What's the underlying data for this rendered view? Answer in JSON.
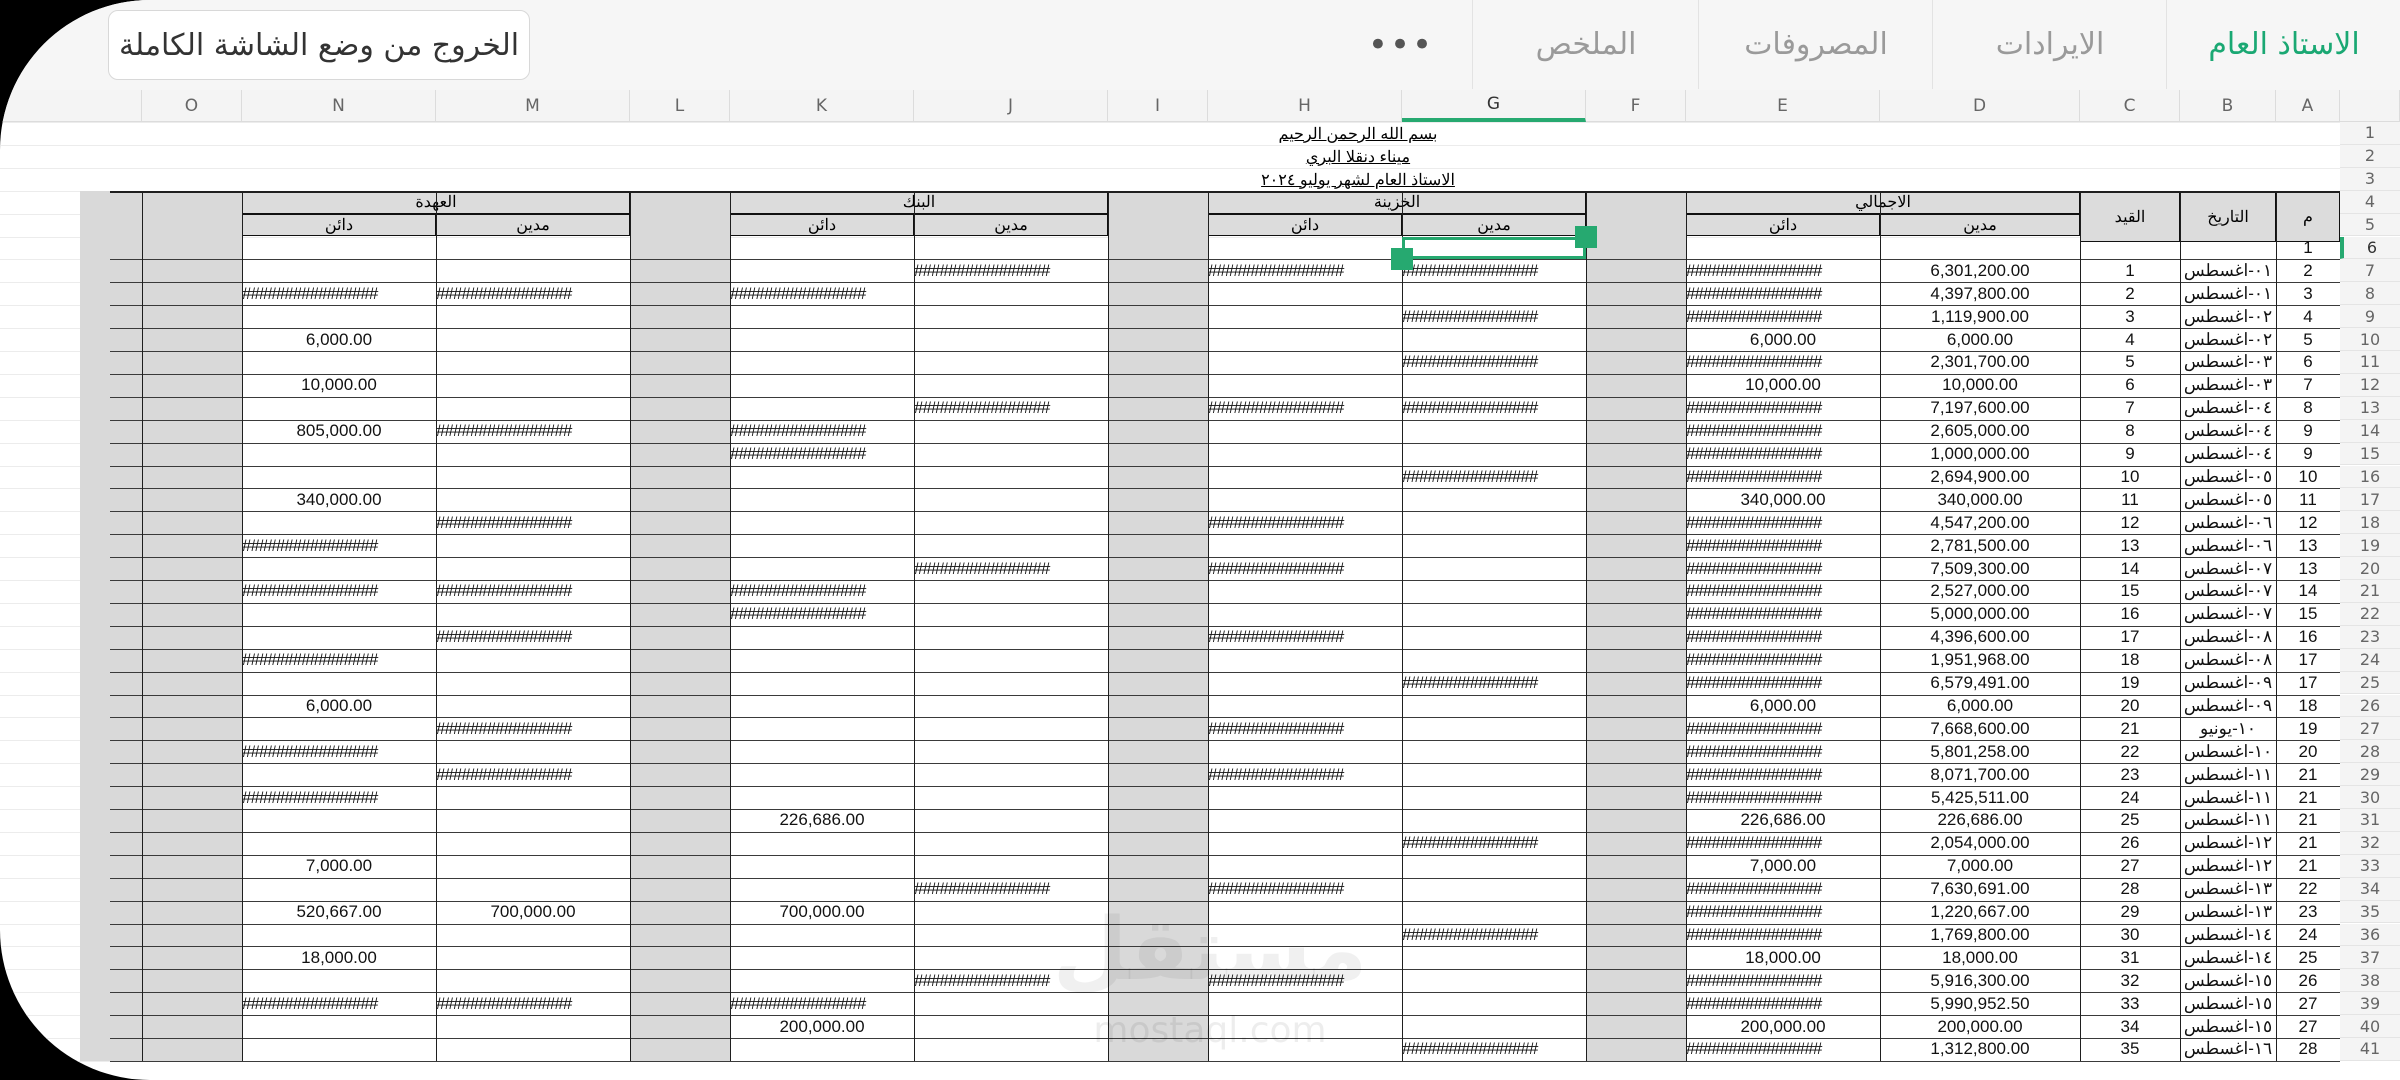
{
  "tabs": [
    {
      "label": "الاستاذ العام",
      "active": true
    },
    {
      "label": "الايرادات",
      "active": false
    },
    {
      "label": "المصروفات",
      "active": false
    },
    {
      "label": "الملخص",
      "active": false
    }
  ],
  "more_label": "•••",
  "exit_fullscreen_label": "الخروج من وضع الشاشة الكاملة",
  "columns": [
    "A",
    "B",
    "C",
    "D",
    "E",
    "F",
    "G",
    "H",
    "I",
    "J",
    "K",
    "L",
    "M",
    "N",
    "O"
  ],
  "selected_column": "G",
  "row_numbers": [
    "1",
    "2",
    "3",
    "4",
    "5",
    "6",
    "7",
    "8",
    "9",
    "10",
    "11",
    "12",
    "13",
    "14",
    "15",
    "16",
    "17",
    "18",
    "19",
    "20",
    "21",
    "22",
    "23",
    "24",
    "25",
    "26",
    "27",
    "28",
    "29",
    "30",
    "31",
    "32",
    "33",
    "34",
    "35",
    "36",
    "37",
    "38",
    "39",
    "40",
    "41"
  ],
  "selected_row": "6",
  "sheet": {
    "title1": "بسم الله الرحمن الرحيم",
    "title2": "ميناء دنقلا البري",
    "title3": "الاستاذ العام لشهر يوليو ٢٠٢٤",
    "group_total": "الاجمالي",
    "group_treasury": "الخزينة",
    "group_bank": "البنك",
    "group_custody": "العهدة",
    "hdr_m": "م",
    "hdr_date": "التاريخ",
    "hdr_entry": "القيد",
    "hdr_debit": "مدين",
    "hdr_credit": "دائن"
  },
  "hash": "################",
  "rows": [
    {
      "m": "1",
      "date": "",
      "entry": "",
      "D": "",
      "E": "",
      "G": "",
      "H": "",
      "J": "",
      "K": "",
      "M": "",
      "N": ""
    },
    {
      "m": "2",
      "date": "٠١-اغسطس",
      "entry": "1",
      "D": "6,301,200.00",
      "E": "#",
      "G": "#",
      "H": "#",
      "J": "#",
      "K": "",
      "M": "",
      "N": ""
    },
    {
      "m": "3",
      "date": "٠١-اغسطس",
      "entry": "2",
      "D": "4,397,800.00",
      "E": "#",
      "G": "",
      "H": "",
      "J": "",
      "K": "#",
      "M": "#",
      "N": "#"
    },
    {
      "m": "4",
      "date": "٠٢-اغسطس",
      "entry": "3",
      "D": "1,119,900.00",
      "E": "#",
      "G": "#",
      "H": "",
      "J": "",
      "K": "",
      "M": "",
      "N": ""
    },
    {
      "m": "5",
      "date": "٠٢-اغسطس",
      "entry": "4",
      "D": "6,000.00",
      "E": "6,000.00",
      "G": "",
      "H": "",
      "J": "",
      "K": "",
      "M": "",
      "N": "6,000.00"
    },
    {
      "m": "6",
      "date": "٠٣-اغسطس",
      "entry": "5",
      "D": "2,301,700.00",
      "E": "#",
      "G": "#",
      "H": "",
      "J": "",
      "K": "",
      "M": "",
      "N": ""
    },
    {
      "m": "7",
      "date": "٠٣-اغسطس",
      "entry": "6",
      "D": "10,000.00",
      "E": "10,000.00",
      "G": "",
      "H": "",
      "J": "",
      "K": "",
      "M": "",
      "N": "10,000.00"
    },
    {
      "m": "8",
      "date": "٠٤-اغسطس",
      "entry": "7",
      "D": "7,197,600.00",
      "E": "#",
      "G": "#",
      "H": "#",
      "J": "#",
      "K": "",
      "M": "",
      "N": ""
    },
    {
      "m": "9",
      "date": "٠٤-اغسطس",
      "entry": "8",
      "D": "2,605,000.00",
      "E": "#",
      "G": "",
      "H": "",
      "J": "",
      "K": "#",
      "M": "#",
      "N": "805,000.00"
    },
    {
      "m": "9",
      "date": "٠٤-اغسطس",
      "entry": "9",
      "D": "1,000,000.00",
      "E": "#",
      "G": "",
      "H": "",
      "J": "",
      "K": "#",
      "M": "",
      "N": ""
    },
    {
      "m": "10",
      "date": "٠٥-اغسطس",
      "entry": "10",
      "D": "2,694,900.00",
      "E": "#",
      "G": "#",
      "H": "",
      "J": "",
      "K": "",
      "M": "",
      "N": ""
    },
    {
      "m": "11",
      "date": "٠٥-اغسطس",
      "entry": "11",
      "D": "340,000.00",
      "E": "340,000.00",
      "G": "",
      "H": "",
      "J": "",
      "K": "",
      "M": "",
      "N": "340,000.00"
    },
    {
      "m": "12",
      "date": "٠٦-اغسطس",
      "entry": "12",
      "D": "4,547,200.00",
      "E": "#",
      "G": "",
      "H": "#",
      "J": "",
      "K": "",
      "M": "#",
      "N": ""
    },
    {
      "m": "13",
      "date": "٠٦-اغسطس",
      "entry": "13",
      "D": "2,781,500.00",
      "E": "#",
      "G": "",
      "H": "",
      "J": "",
      "K": "",
      "M": "",
      "N": "#"
    },
    {
      "m": "13",
      "date": "٠٧-اغسطس",
      "entry": "14",
      "D": "7,509,300.00",
      "E": "#",
      "G": "",
      "H": "#",
      "J": "#",
      "K": "",
      "M": "",
      "N": ""
    },
    {
      "m": "14",
      "date": "٠٧-اغسطس",
      "entry": "15",
      "D": "2,527,000.00",
      "E": "#",
      "G": "",
      "H": "",
      "J": "",
      "K": "#",
      "M": "#",
      "N": "#"
    },
    {
      "m": "15",
      "date": "٠٧-اغسطس",
      "entry": "16",
      "D": "5,000,000.00",
      "E": "#",
      "G": "",
      "H": "",
      "J": "",
      "K": "#",
      "M": "",
      "N": ""
    },
    {
      "m": "16",
      "date": "٠٨-اغسطس",
      "entry": "17",
      "D": "4,396,600.00",
      "E": "#",
      "G": "",
      "H": "#",
      "J": "",
      "K": "",
      "M": "#",
      "N": ""
    },
    {
      "m": "17",
      "date": "٠٨-اغسطس",
      "entry": "18",
      "D": "1,951,968.00",
      "E": "#",
      "G": "",
      "H": "",
      "J": "",
      "K": "",
      "M": "",
      "N": "#"
    },
    {
      "m": "17",
      "date": "٠٩-اغسطس",
      "entry": "19",
      "D": "6,579,491.00",
      "E": "#",
      "G": "#",
      "H": "",
      "J": "",
      "K": "",
      "M": "",
      "N": ""
    },
    {
      "m": "18",
      "date": "٠٩-اغسطس",
      "entry": "20",
      "D": "6,000.00",
      "E": "6,000.00",
      "G": "",
      "H": "",
      "J": "",
      "K": "",
      "M": "",
      "N": "6,000.00"
    },
    {
      "m": "19",
      "date": "١٠-يونيو",
      "entry": "21",
      "D": "7,668,600.00",
      "E": "#",
      "G": "",
      "H": "#",
      "J": "",
      "K": "",
      "M": "#",
      "N": ""
    },
    {
      "m": "20",
      "date": "١٠-اغسطس",
      "entry": "22",
      "D": "5,801,258.00",
      "E": "#",
      "G": "",
      "H": "",
      "J": "",
      "K": "",
      "M": "",
      "N": "#"
    },
    {
      "m": "21",
      "date": "١١-اغسطس",
      "entry": "23",
      "D": "8,071,700.00",
      "E": "#",
      "G": "",
      "H": "#",
      "J": "",
      "K": "",
      "M": "#",
      "N": ""
    },
    {
      "m": "21",
      "date": "١١-اغسطس",
      "entry": "24",
      "D": "5,425,511.00",
      "E": "#",
      "G": "",
      "H": "",
      "J": "",
      "K": "",
      "M": "",
      "N": "#"
    },
    {
      "m": "21",
      "date": "١١-اغسطس",
      "entry": "25",
      "D": "226,686.00",
      "E": "226,686.00",
      "G": "",
      "H": "",
      "J": "",
      "K": "226,686.00",
      "M": "",
      "N": ""
    },
    {
      "m": "21",
      "date": "١٢-اغسطس",
      "entry": "26",
      "D": "2,054,000.00",
      "E": "#",
      "G": "#",
      "H": "",
      "J": "",
      "K": "",
      "M": "",
      "N": ""
    },
    {
      "m": "21",
      "date": "١٢-اغسطس",
      "entry": "27",
      "D": "7,000.00",
      "E": "7,000.00",
      "G": "",
      "H": "",
      "J": "",
      "K": "",
      "M": "",
      "N": "7,000.00"
    },
    {
      "m": "22",
      "date": "١٣-اغسطس",
      "entry": "28",
      "D": "7,630,691.00",
      "E": "#",
      "G": "",
      "H": "#",
      "J": "#",
      "K": "",
      "M": "",
      "N": ""
    },
    {
      "m": "23",
      "date": "١٣-اغسطس",
      "entry": "29",
      "D": "1,220,667.00",
      "E": "#",
      "G": "",
      "H": "",
      "J": "",
      "K": "700,000.00",
      "M": "700,000.00",
      "N": "520,667.00"
    },
    {
      "m": "24",
      "date": "١٤-اغسطس",
      "entry": "30",
      "D": "1,769,800.00",
      "E": "#",
      "G": "#",
      "H": "",
      "J": "",
      "K": "",
      "M": "",
      "N": ""
    },
    {
      "m": "25",
      "date": "١٤-اغسطس",
      "entry": "31",
      "D": "18,000.00",
      "E": "18,000.00",
      "G": "",
      "H": "",
      "J": "",
      "K": "",
      "M": "",
      "N": "18,000.00"
    },
    {
      "m": "26",
      "date": "١٥-اغسطس",
      "entry": "32",
      "D": "5,916,300.00",
      "E": "#",
      "G": "",
      "H": "#",
      "J": "#",
      "K": "",
      "M": "",
      "N": ""
    },
    {
      "m": "27",
      "date": "١٥-اغسطس",
      "entry": "33",
      "D": "5,990,952.50",
      "E": "#",
      "G": "",
      "H": "",
      "J": "",
      "K": "#",
      "M": "#",
      "N": "#"
    },
    {
      "m": "27",
      "date": "١٥-اغسطس",
      "entry": "34",
      "D": "200,000.00",
      "E": "200,000.00",
      "G": "",
      "H": "",
      "J": "",
      "K": "200,000.00",
      "M": "",
      "N": ""
    },
    {
      "m": "28",
      "date": "١٦-اغسطس",
      "entry": "35",
      "D": "1,312,800.00",
      "E": "#",
      "G": "#",
      "H": "",
      "J": "",
      "K": "",
      "M": "",
      "N": ""
    }
  ],
  "watermark": "مستقل",
  "watermark_sub": "mostaql.com"
}
